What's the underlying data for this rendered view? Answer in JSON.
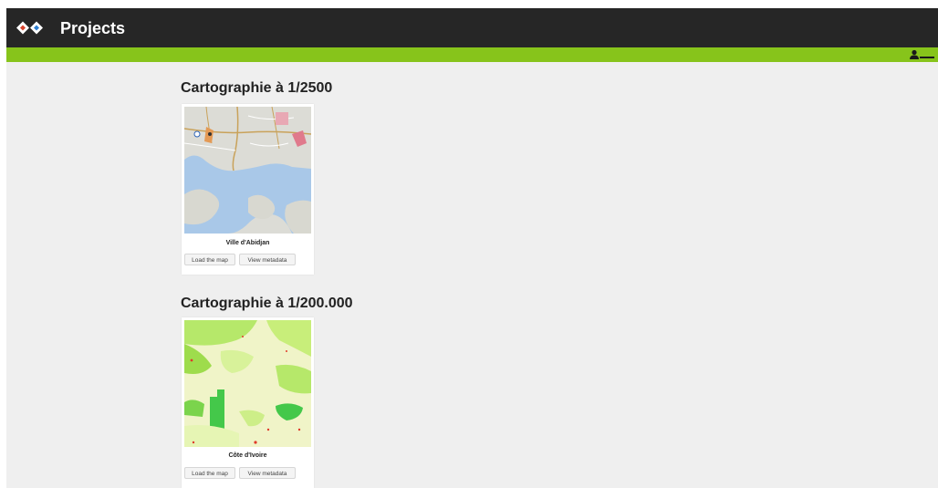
{
  "header": {
    "title": "Projects",
    "colors": {
      "topbar": "#262626",
      "accent_bar": "#87c41b"
    }
  },
  "user_menu": {
    "icon": "user-icon"
  },
  "sections": [
    {
      "title": "Cartographie à 1/2500",
      "projects": [
        {
          "name": "Ville d'Abidjan",
          "thumbnail": "street-map-thumbnail",
          "load_label": "Load the map",
          "metadata_label": "View metadata"
        }
      ]
    },
    {
      "title": "Cartographie à 1/200.000",
      "projects": [
        {
          "name": "Côte d'Ivoire",
          "thumbnail": "vegetation-map-thumbnail",
          "load_label": "Load the map",
          "metadata_label": "View metadata"
        }
      ]
    }
  ]
}
